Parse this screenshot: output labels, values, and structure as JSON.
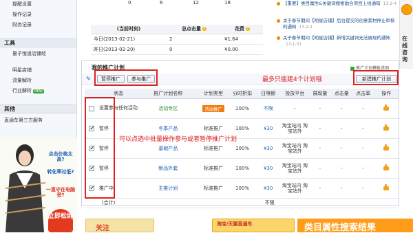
{
  "sidebar": {
    "links_top": [
      "提醒设置",
      "操作记录",
      "财务记录"
    ],
    "sections": [
      {
        "title": "工具",
        "items": [
          "量子恒道店铺经"
        ]
      },
      {
        "title": "",
        "items": [
          "明星店铺",
          "流量解析",
          "行业解析"
        ]
      },
      {
        "title": "其他",
        "items": [
          "直通车第三方服务"
        ]
      }
    ],
    "new_badge": "NEW"
  },
  "ad": {
    "q1": "点击价格太高?",
    "q2": "转化率过低?",
    "q3": "一直守在电脑旁?",
    "cta": "立即松绑"
  },
  "axis": [
    "0",
    "6",
    "12",
    "18"
  ],
  "stats": {
    "headers": [
      "(当前时刻)",
      "总点击量",
      "花费"
    ],
    "rows": [
      {
        "date": "今日(2013-02-21)",
        "clicks": "2",
        "cost": "¥1.64"
      },
      {
        "date": "昨日(2013-02-20)",
        "clicks": "0",
        "cost": "¥0.00"
      }
    ]
  },
  "news": [
    {
      "text": "【重要】类目属性&关键词搜索融合项目上线通知",
      "date": "13-2-4"
    },
    {
      "text": "关于春节期间【明星店铺】后台提交的创意素材停止审核的通知",
      "date": "13-2-1"
    },
    {
      "text": "关于春节期间【明星店铺】新增关键词无法展现的通知",
      "date": "13-1-31"
    }
  ],
  "side_tab": {
    "label": "在线咨询"
  },
  "plan": {
    "title": "我的推广计划",
    "limit_note": "推广计划模板说明",
    "pause_button": "暂停推广",
    "resume_button": "参与推广",
    "new_button": "新建推广计划",
    "max_note": "最多只能建4个计划哦",
    "batch_note": "可以点选中批量操作参与或者暂停推广计划",
    "columns": [
      "",
      "状态",
      "推广计划名称",
      "计划类型",
      "分时折扣",
      "日限额",
      "投放平台",
      "展现量",
      "点击量",
      "点击率",
      "操作"
    ],
    "rows": [
      {
        "checked": false,
        "status": "设置参与任何活动",
        "name": "活动专区",
        "type": "活动推广",
        "discount": "100%",
        "limit": "不限",
        "platform": "-",
        "impressions": "-",
        "clicks": "-",
        "ctr": "-"
      },
      {
        "checked": true,
        "status": "暂停",
        "name": "冬季产品",
        "type": "标准推广",
        "discount": "100%",
        "limit": "¥30",
        "platform": "淘宝站内 淘宝站外",
        "impressions": "-",
        "clicks": "-",
        "ctr": "-"
      },
      {
        "checked": true,
        "status": "暂停",
        "name": "基础产品",
        "type": "标准推广",
        "discount": "100%",
        "limit": "¥30",
        "platform": "淘宝站内 淘宝站外",
        "impressions": "-",
        "clicks": "-",
        "ctr": "-"
      },
      {
        "checked": true,
        "status": "暂停",
        "name": "新品外套",
        "type": "标准推广",
        "discount": "100%",
        "limit": "¥30",
        "platform": "淘宝站内 淘宝站外",
        "impressions": "-",
        "clicks": "-",
        "ctr": "-"
      },
      {
        "checked": true,
        "status": "推广中",
        "name": "主推计划",
        "type": "标准推广",
        "discount": "100%",
        "limit": "¥30",
        "platform": "淘宝站内 淘宝站外",
        "impressions": "-",
        "clicks": "-",
        "ctr": "-"
      }
    ],
    "total_label": "(合计)",
    "total_limit": "不限"
  },
  "banners": {
    "left": "关注",
    "mid": "淘宝/天猫直通车",
    "right": "类目属性搜索结果"
  },
  "colors": {
    "accent_red": "#e0201f",
    "link_blue": "#1a5fb4",
    "orange": "#f07d10"
  }
}
